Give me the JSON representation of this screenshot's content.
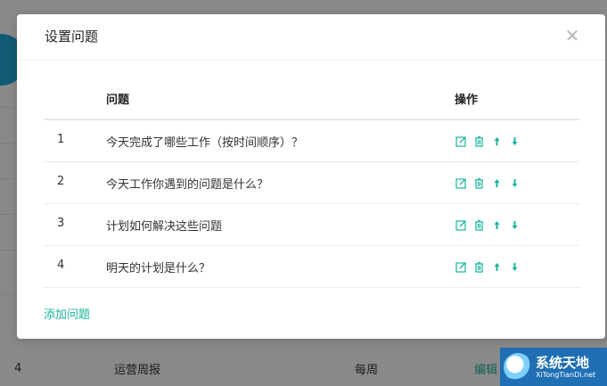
{
  "background": {
    "row": {
      "index": "4",
      "name": "运营周报",
      "frequency": "每周",
      "action": "编辑"
    }
  },
  "modal": {
    "title": "设置问题",
    "close_icon": "close-icon",
    "table": {
      "headers": {
        "number": "",
        "question": "问题",
        "operations": "操作"
      },
      "rows": [
        {
          "index": "1",
          "question": "今天完成了哪些工作（按时间顺序）？"
        },
        {
          "index": "2",
          "question": "今天工作你遇到的问题是什么？"
        },
        {
          "index": "3",
          "question": "计划如何解决这些问题"
        },
        {
          "index": "4",
          "question": "明天的计划是什么？"
        }
      ],
      "row_icons": [
        "edit-icon",
        "trash-icon",
        "arrow-up-icon",
        "arrow-down-icon"
      ]
    },
    "add_label": "添加问题"
  },
  "watermark": {
    "title": "系统天地",
    "url": "XiTongTianDi.net"
  },
  "colors": {
    "accent": "#18b39b",
    "mask": "rgba(0,0,0,0.45)"
  }
}
